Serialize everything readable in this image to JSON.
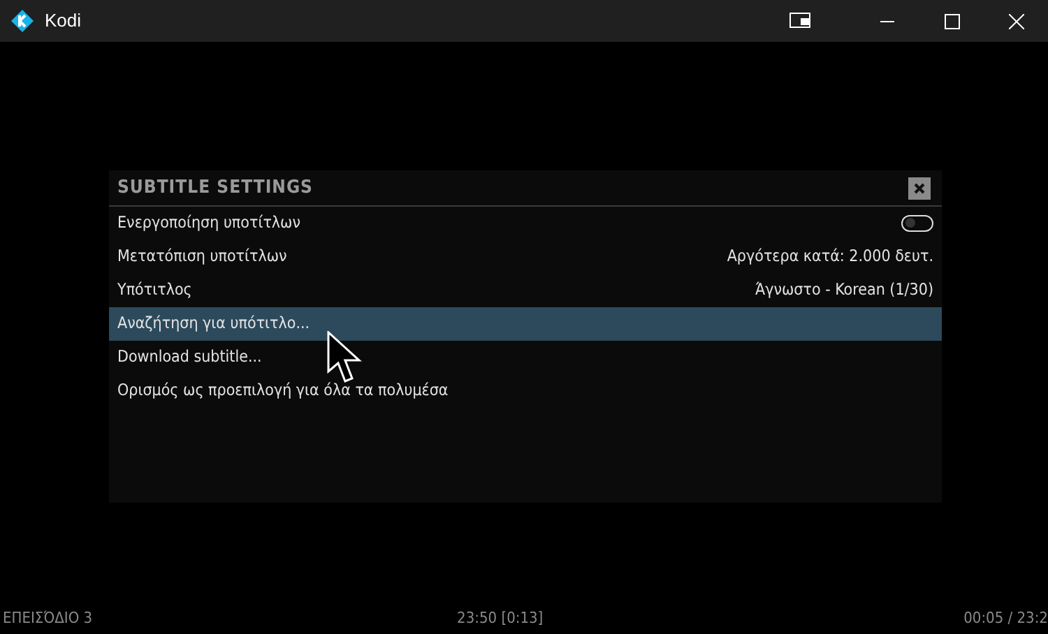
{
  "window": {
    "title": "Kodi"
  },
  "dialog": {
    "title": "SUBTITLE SETTINGS",
    "items": [
      {
        "label": "Ενεργοποίηση υποτίτλων",
        "kind": "toggle",
        "on": false,
        "selected": false
      },
      {
        "label": "Μετατόπιση υποτίτλων",
        "kind": "value",
        "value": "Αργότερα κατά: 2.000 δευτ.",
        "selected": false
      },
      {
        "label": "Υπότιτλος",
        "kind": "value",
        "value": "Άγνωστο - Korean (1/30)",
        "selected": false
      },
      {
        "label": "Αναζήτηση για υπότιτλο...",
        "kind": "action",
        "selected": true
      },
      {
        "label": "Download subtitle...",
        "kind": "action",
        "selected": false
      },
      {
        "label": "Ορισμός ως προεπιλογή για όλα τα πολυμέσα",
        "kind": "action",
        "selected": false
      }
    ]
  },
  "status_bar": {
    "left": "ΕΠΕΙΣΌΔΙΟ 3",
    "center": "23:50 [0:13]",
    "right": "00:05 / 23:2"
  }
}
